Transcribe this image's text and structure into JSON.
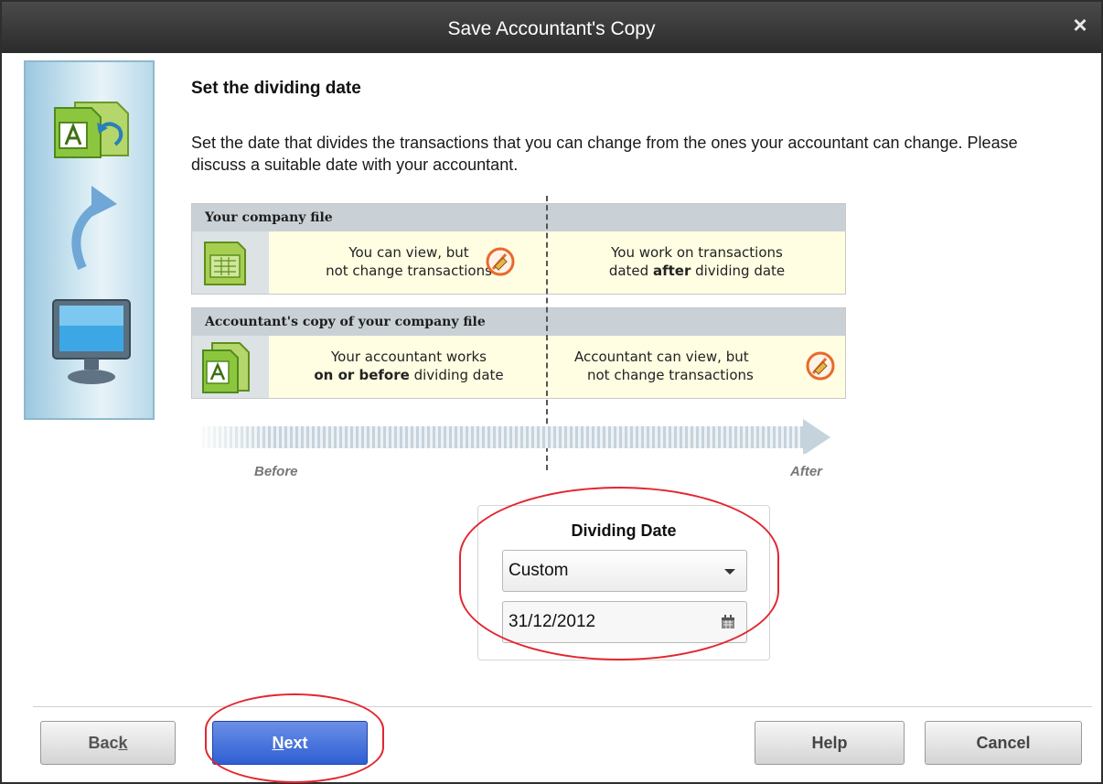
{
  "window": {
    "title": "Save Accountant's Copy",
    "close_icon": "×"
  },
  "content": {
    "heading": "Set the dividing date",
    "description": "Set the date that divides the transactions that you can change from the ones your accountant can change. Please discuss a suitable date with your accountant."
  },
  "diagram": {
    "company_file": {
      "header": "Your company file",
      "left_line1": "You can view, but",
      "left_line2": "not change transactions",
      "right_line1": "You work on transactions",
      "right_line2_pre": "dated ",
      "right_line2_bold": "after",
      "right_line2_post": " dividing date"
    },
    "accountant_copy": {
      "header": "Accountant's copy of your company file",
      "left_line1": "Your accountant works",
      "left_line2_bold": "on or before",
      "left_line2_post": " dividing date",
      "right_line1": "Accountant can view, but",
      "right_line2": "not change transactions"
    },
    "before_label": "Before",
    "after_label": "After"
  },
  "dividing_date": {
    "title": "Dividing Date",
    "selected_option": "Custom",
    "date_value": "31/12/2012"
  },
  "buttons": {
    "back_pre": "Bac",
    "back_ul": "k",
    "next_ul": "N",
    "next_post": "ext",
    "help": "Help",
    "cancel": "Cancel"
  },
  "colors": {
    "titlebar": "#2b2b2b",
    "panel_header": "#c9d1d6",
    "cell_bg": "#fffde2",
    "primary_button": "#2f5fd4",
    "highlight_oval": "#e3262f"
  }
}
